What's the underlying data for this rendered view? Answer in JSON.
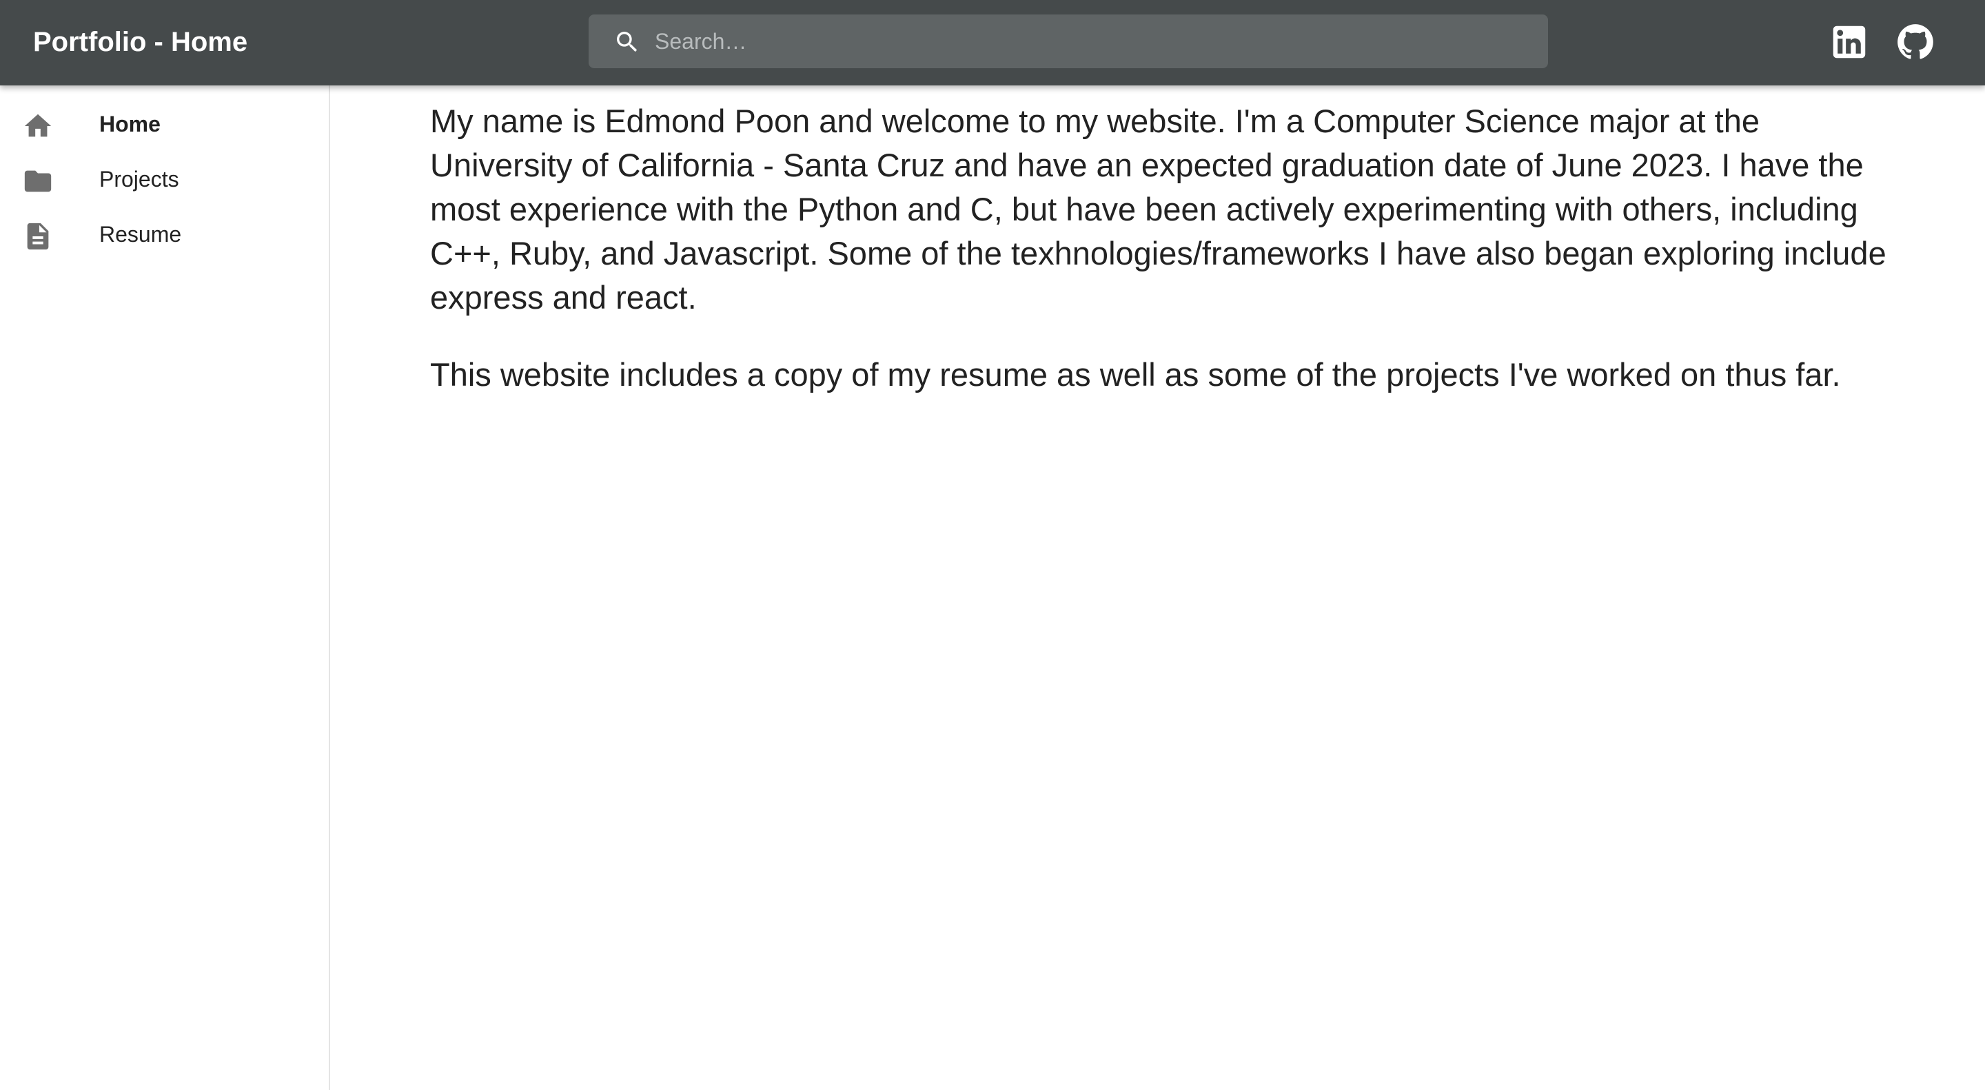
{
  "header": {
    "title": "Portfolio - Home",
    "search": {
      "placeholder": "Search…",
      "value": ""
    },
    "social": [
      {
        "label": "LinkedIn",
        "icon": "linkedin-icon"
      },
      {
        "label": "GitHub",
        "icon": "github-icon"
      }
    ]
  },
  "sidebar": {
    "items": [
      {
        "label": "Home",
        "icon": "home-icon",
        "active": true
      },
      {
        "label": "Projects",
        "icon": "folder-icon",
        "active": false
      },
      {
        "label": "Resume",
        "icon": "document-icon",
        "active": false
      }
    ]
  },
  "main": {
    "paragraphs": [
      "My name is Edmond Poon and welcome to my website. I'm a Computer Science major at the University of California - Santa Cruz and have an expected graduation date of June 2023. I have the most experience with the Python and C, but have been actively experimenting with others, including C++, Ruby, and Javascript. Some of the texhnologies/frameworks I have also began exploring include express and react.",
      "This website includes a copy of my resume as well as some of the projects I've worked on thus far."
    ]
  },
  "colors": {
    "appbar": "#454a4b",
    "search_background": "#5f6465",
    "icon_gray": "#6e6e6e",
    "text": "#222222"
  }
}
